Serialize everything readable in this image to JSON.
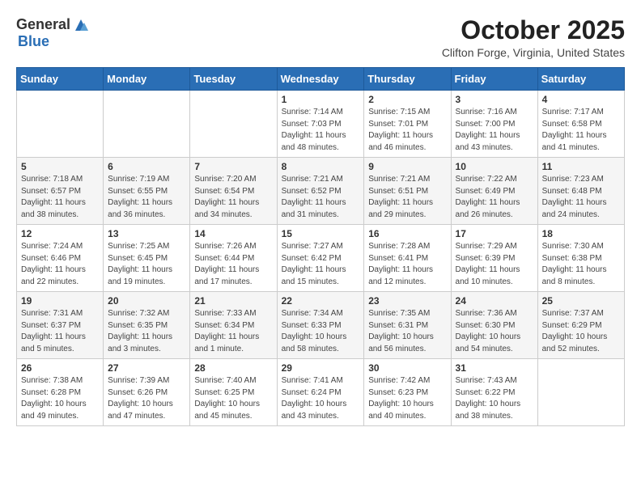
{
  "header": {
    "logo_general": "General",
    "logo_blue": "Blue",
    "month": "October 2025",
    "location": "Clifton Forge, Virginia, United States"
  },
  "weekdays": [
    "Sunday",
    "Monday",
    "Tuesday",
    "Wednesday",
    "Thursday",
    "Friday",
    "Saturday"
  ],
  "weeks": [
    [
      {
        "day": "",
        "info": ""
      },
      {
        "day": "",
        "info": ""
      },
      {
        "day": "",
        "info": ""
      },
      {
        "day": "1",
        "info": "Sunrise: 7:14 AM\nSunset: 7:03 PM\nDaylight: 11 hours\nand 48 minutes."
      },
      {
        "day": "2",
        "info": "Sunrise: 7:15 AM\nSunset: 7:01 PM\nDaylight: 11 hours\nand 46 minutes."
      },
      {
        "day": "3",
        "info": "Sunrise: 7:16 AM\nSunset: 7:00 PM\nDaylight: 11 hours\nand 43 minutes."
      },
      {
        "day": "4",
        "info": "Sunrise: 7:17 AM\nSunset: 6:58 PM\nDaylight: 11 hours\nand 41 minutes."
      }
    ],
    [
      {
        "day": "5",
        "info": "Sunrise: 7:18 AM\nSunset: 6:57 PM\nDaylight: 11 hours\nand 38 minutes."
      },
      {
        "day": "6",
        "info": "Sunrise: 7:19 AM\nSunset: 6:55 PM\nDaylight: 11 hours\nand 36 minutes."
      },
      {
        "day": "7",
        "info": "Sunrise: 7:20 AM\nSunset: 6:54 PM\nDaylight: 11 hours\nand 34 minutes."
      },
      {
        "day": "8",
        "info": "Sunrise: 7:21 AM\nSunset: 6:52 PM\nDaylight: 11 hours\nand 31 minutes."
      },
      {
        "day": "9",
        "info": "Sunrise: 7:21 AM\nSunset: 6:51 PM\nDaylight: 11 hours\nand 29 minutes."
      },
      {
        "day": "10",
        "info": "Sunrise: 7:22 AM\nSunset: 6:49 PM\nDaylight: 11 hours\nand 26 minutes."
      },
      {
        "day": "11",
        "info": "Sunrise: 7:23 AM\nSunset: 6:48 PM\nDaylight: 11 hours\nand 24 minutes."
      }
    ],
    [
      {
        "day": "12",
        "info": "Sunrise: 7:24 AM\nSunset: 6:46 PM\nDaylight: 11 hours\nand 22 minutes."
      },
      {
        "day": "13",
        "info": "Sunrise: 7:25 AM\nSunset: 6:45 PM\nDaylight: 11 hours\nand 19 minutes."
      },
      {
        "day": "14",
        "info": "Sunrise: 7:26 AM\nSunset: 6:44 PM\nDaylight: 11 hours\nand 17 minutes."
      },
      {
        "day": "15",
        "info": "Sunrise: 7:27 AM\nSunset: 6:42 PM\nDaylight: 11 hours\nand 15 minutes."
      },
      {
        "day": "16",
        "info": "Sunrise: 7:28 AM\nSunset: 6:41 PM\nDaylight: 11 hours\nand 12 minutes."
      },
      {
        "day": "17",
        "info": "Sunrise: 7:29 AM\nSunset: 6:39 PM\nDaylight: 11 hours\nand 10 minutes."
      },
      {
        "day": "18",
        "info": "Sunrise: 7:30 AM\nSunset: 6:38 PM\nDaylight: 11 hours\nand 8 minutes."
      }
    ],
    [
      {
        "day": "19",
        "info": "Sunrise: 7:31 AM\nSunset: 6:37 PM\nDaylight: 11 hours\nand 5 minutes."
      },
      {
        "day": "20",
        "info": "Sunrise: 7:32 AM\nSunset: 6:35 PM\nDaylight: 11 hours\nand 3 minutes."
      },
      {
        "day": "21",
        "info": "Sunrise: 7:33 AM\nSunset: 6:34 PM\nDaylight: 11 hours\nand 1 minute."
      },
      {
        "day": "22",
        "info": "Sunrise: 7:34 AM\nSunset: 6:33 PM\nDaylight: 10 hours\nand 58 minutes."
      },
      {
        "day": "23",
        "info": "Sunrise: 7:35 AM\nSunset: 6:31 PM\nDaylight: 10 hours\nand 56 minutes."
      },
      {
        "day": "24",
        "info": "Sunrise: 7:36 AM\nSunset: 6:30 PM\nDaylight: 10 hours\nand 54 minutes."
      },
      {
        "day": "25",
        "info": "Sunrise: 7:37 AM\nSunset: 6:29 PM\nDaylight: 10 hours\nand 52 minutes."
      }
    ],
    [
      {
        "day": "26",
        "info": "Sunrise: 7:38 AM\nSunset: 6:28 PM\nDaylight: 10 hours\nand 49 minutes."
      },
      {
        "day": "27",
        "info": "Sunrise: 7:39 AM\nSunset: 6:26 PM\nDaylight: 10 hours\nand 47 minutes."
      },
      {
        "day": "28",
        "info": "Sunrise: 7:40 AM\nSunset: 6:25 PM\nDaylight: 10 hours\nand 45 minutes."
      },
      {
        "day": "29",
        "info": "Sunrise: 7:41 AM\nSunset: 6:24 PM\nDaylight: 10 hours\nand 43 minutes."
      },
      {
        "day": "30",
        "info": "Sunrise: 7:42 AM\nSunset: 6:23 PM\nDaylight: 10 hours\nand 40 minutes."
      },
      {
        "day": "31",
        "info": "Sunrise: 7:43 AM\nSunset: 6:22 PM\nDaylight: 10 hours\nand 38 minutes."
      },
      {
        "day": "",
        "info": ""
      }
    ]
  ]
}
